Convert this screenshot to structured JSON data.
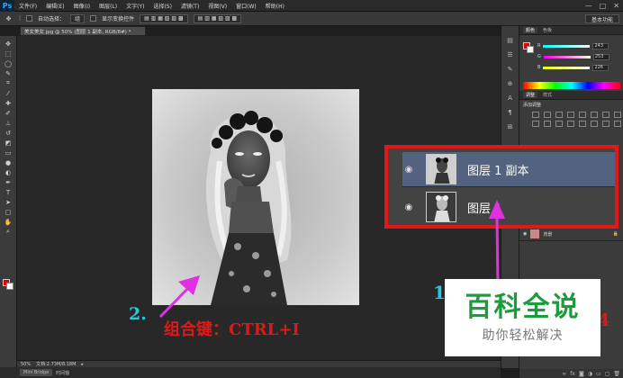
{
  "app": {
    "logo": "Ps",
    "menu": [
      "文件(F)",
      "编辑(E)",
      "图像(I)",
      "图层(L)",
      "文字(Y)",
      "选择(S)",
      "滤镜(T)",
      "视图(V)",
      "窗口(W)",
      "帮助(H)"
    ],
    "window_controls": [
      "—",
      "□",
      "✕"
    ]
  },
  "options_bar": {
    "auto_select": "自动选择：",
    "auto_select_value": "组",
    "show_transform": "显示变换控件",
    "workspace": "基本功能"
  },
  "document": {
    "tab_title": "美女美女.jpg @ 50% (图层 1 副本, RGB/8#) *",
    "zoom": "50%",
    "doc_size": "文档:2.73M/8.18M"
  },
  "bottom_tabs": [
    "Mini Bridge",
    "时间轴"
  ],
  "color_panel": {
    "tabs": [
      "颜色",
      "色板"
    ],
    "fg_color": "#e00000",
    "bg_color": "#ffffff",
    "channels": [
      {
        "label": "R",
        "value": "243",
        "gradient": "linear-gradient(to right,#00fcfc,#fcfcfc)"
      },
      {
        "label": "G",
        "value": "253",
        "gradient": "linear-gradient(to right,#f300e2,#f3fce2)"
      },
      {
        "label": "B",
        "value": "226",
        "gradient": "linear-gradient(to right,#f3fd00,#f3fdff)"
      }
    ]
  },
  "adjust_panel": {
    "tabs": [
      "调整",
      "样式"
    ],
    "title": "添加调整"
  },
  "layers_panel_small": {
    "rows": [
      {
        "name": "背景"
      }
    ]
  },
  "zoom_layers": [
    {
      "name": "图层 1 副本",
      "selected": true
    },
    {
      "name": "图层 1",
      "selected": false
    }
  ],
  "annotations": {
    "step2_number": "2.",
    "step2_text": "组合键：CTRL+I",
    "step1_number": "1",
    "step1_tail": "4",
    "arrow_color": "#e030e0"
  },
  "watermark": {
    "title": "百科全说",
    "subtitle": "助你轻松解决"
  }
}
